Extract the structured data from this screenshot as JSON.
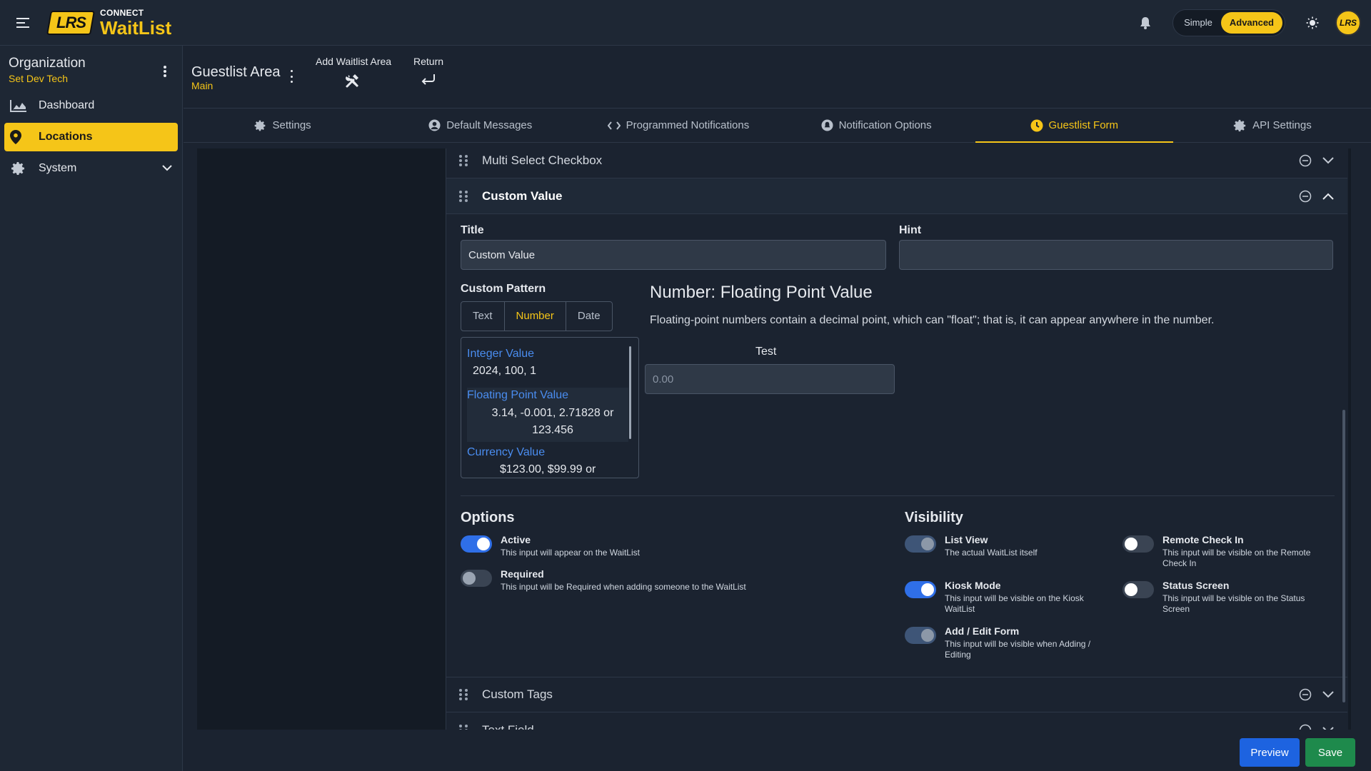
{
  "header": {
    "logo_mark": "LRS",
    "logo_small": "CONNECT",
    "logo_big": "WaitList",
    "mode_simple": "Simple",
    "mode_advanced": "Advanced",
    "avatar_text": "LRS"
  },
  "sidebar": {
    "org_title": "Organization",
    "org_sub": "Set Dev Tech",
    "items": [
      {
        "label": "Dashboard",
        "icon": "chart-icon"
      },
      {
        "label": "Locations",
        "icon": "location-pin-icon",
        "active": true
      },
      {
        "label": "System",
        "icon": "gear-icon"
      }
    ]
  },
  "subheader": {
    "title": "Guestlist Area",
    "sub": "Main",
    "add_label": "Add Waitlist Area",
    "return_label": "Return"
  },
  "tabs": [
    {
      "label": "Settings",
      "icon": "gears-icon"
    },
    {
      "label": "Default Messages",
      "icon": "user-circle-icon"
    },
    {
      "label": "Programmed Notifications",
      "icon": "code-icon"
    },
    {
      "label": "Notification Options",
      "icon": "bell-circle-icon"
    },
    {
      "label": "Guestlist Form",
      "icon": "clock-icon",
      "active": true
    },
    {
      "label": "API Settings",
      "icon": "gear-icon"
    }
  ],
  "form": {
    "row_multi": "Multi Select Checkbox",
    "row_custom": "Custom Value",
    "title_label": "Title",
    "title_value": "Custom Value",
    "hint_label": "Hint",
    "hint_value": "",
    "pattern_label": "Custom Pattern",
    "pattern_tabs": [
      "Text",
      "Number",
      "Date"
    ],
    "pattern_items": [
      {
        "title": "Integer Value",
        "value": "2024, 100, 1"
      },
      {
        "title": "Floating Point Value",
        "value": "3.14, -0.001, 2.71828 or 123.456"
      },
      {
        "title": "Currency Value",
        "value": "$123.00, $99.99 or"
      }
    ],
    "number_title": "Number: Floating Point Value",
    "number_desc": "Floating-point numbers contain a decimal point, which can \"float\"; that is, it can appear anywhere in the number.",
    "test_label": "Test",
    "test_placeholder": "0.00",
    "options_title": "Options",
    "visibility_title": "Visibility",
    "options": [
      {
        "title": "Active",
        "desc": "This input will appear on the WaitList",
        "on": true
      },
      {
        "title": "Required",
        "desc": "This input will be Required when adding someone to the WaitList",
        "on": false
      }
    ],
    "visibility": [
      {
        "title": "List View",
        "desc": "The actual WaitList itself",
        "on": true
      },
      {
        "title": "Kiosk Mode",
        "desc": "This input will be visible on the Kiosk WaitList",
        "on": true
      },
      {
        "title": "Add / Edit Form",
        "desc": "This input will be visible when Adding / Editing",
        "on": true
      },
      {
        "title": "Remote Check In",
        "desc": "This input will be visible on the Remote Check In",
        "on": false
      },
      {
        "title": "Status Screen",
        "desc": "This input will be visible on the Status Screen",
        "on": false
      }
    ],
    "row_tags": "Custom Tags",
    "row_text": "Text Field"
  },
  "buttons": {
    "preview": "Preview",
    "save": "Save"
  },
  "colors": {
    "accent": "#f5c518",
    "primary": "#1d63e0",
    "success": "#1e8a4c",
    "background": "#1b2330"
  }
}
